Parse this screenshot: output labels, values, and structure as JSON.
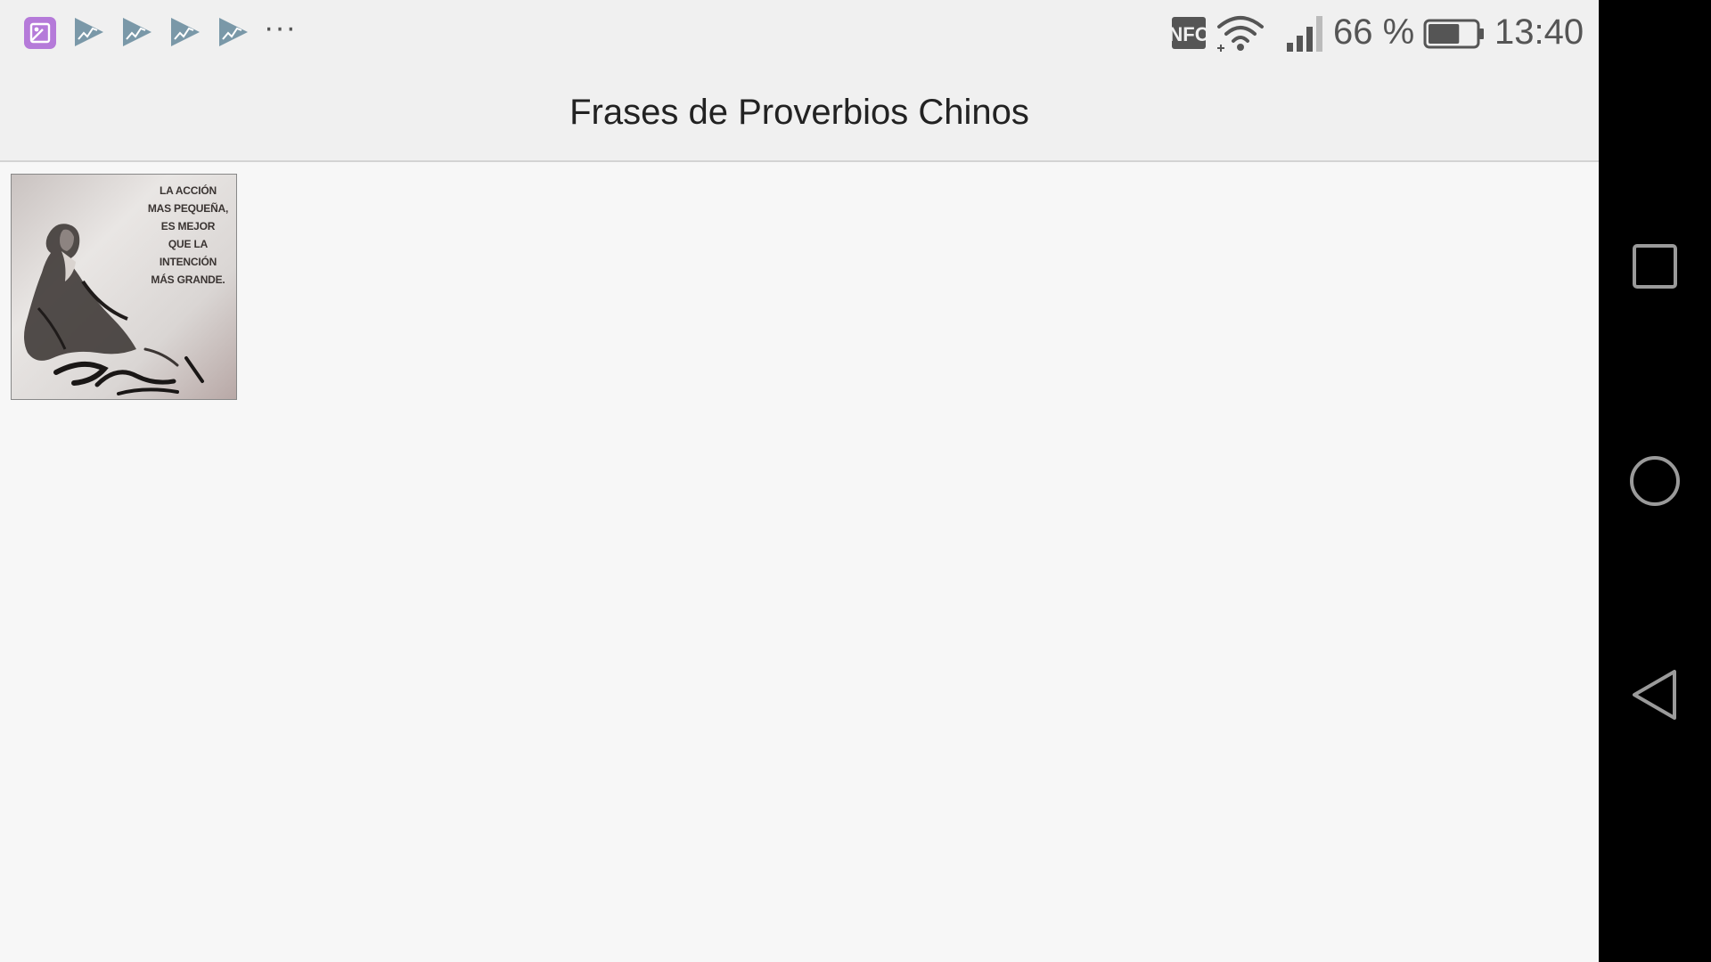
{
  "status_bar": {
    "notification_icons": [
      "gallery-icon",
      "stock-chart-icon",
      "stock-chart-icon",
      "stock-chart-icon",
      "stock-chart-icon"
    ],
    "more_label": "···",
    "nfc_label": "NFC",
    "battery_percent": "66 %",
    "battery_level": 0.66,
    "time": "13:40"
  },
  "app_bar": {
    "title": "Frases de Proverbios Chinos"
  },
  "content": {
    "images": [
      {
        "name": "proverb-image",
        "caption_lines": [
          "LA ACCIÓN",
          "MAS PEQUEÑA,",
          "ES MEJOR",
          "QUE LA",
          "INTENCIÓN",
          "MÁS GRANDE."
        ]
      }
    ]
  },
  "nav_bar": {
    "buttons": [
      "recents-icon",
      "home-icon",
      "back-icon"
    ]
  },
  "colors": {
    "status_bar_bg": "#f0f0f0",
    "content_bg": "#f7f7f7",
    "nav_bar_bg": "#000000",
    "gallery_icon": "#b57ad9",
    "stock_icon": "#7a98a8"
  }
}
